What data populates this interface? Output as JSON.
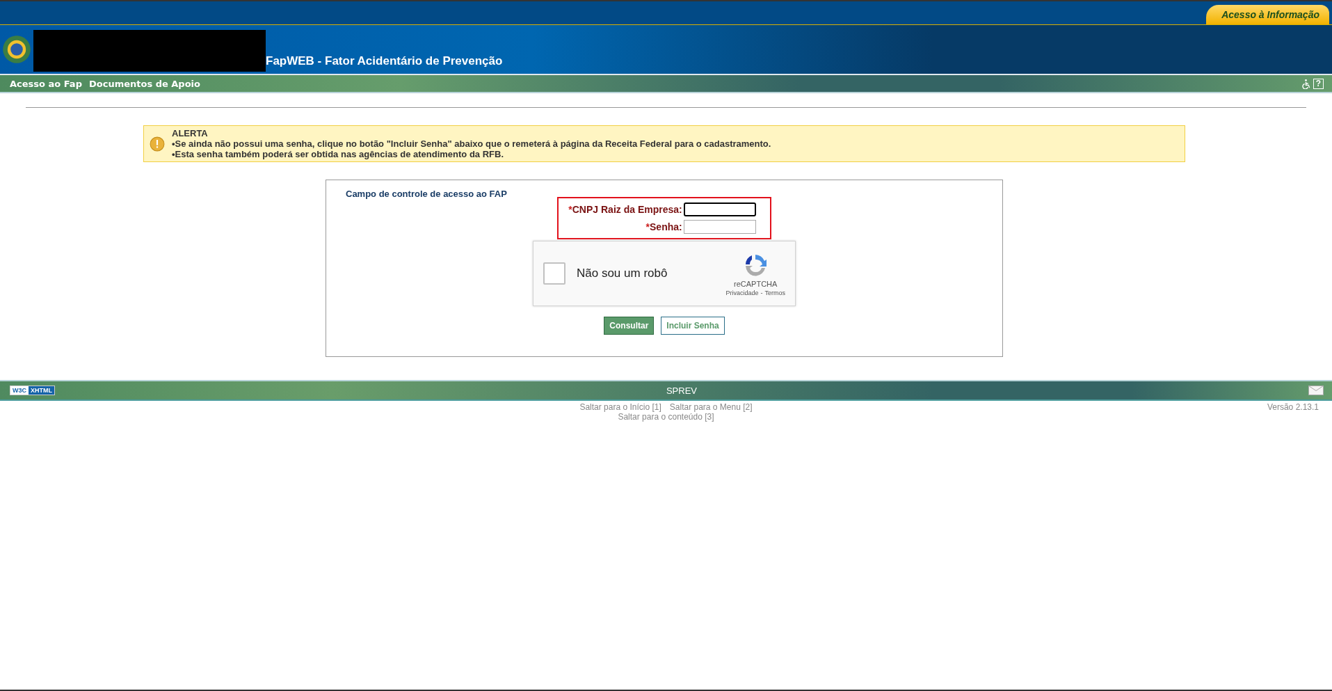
{
  "top_bar": {
    "access_tab": "Acesso à Informação"
  },
  "header": {
    "title": "FapWEB - Fator Acidentário de Prevenção"
  },
  "nav": {
    "items": [
      "Acesso ao Fap",
      "Documentos de Apoio"
    ],
    "help": "?"
  },
  "alert": {
    "title": "ALERTA",
    "lines": [
      "•Se ainda não possui uma senha, clique no botão \"Incluir Senha\" abaixo que o remeterá à página da Receita Federal para o cadastramento.",
      "•Esta senha também poderá ser obtida nas agências de atendimento da RFB."
    ]
  },
  "form": {
    "title": "Campo de controle de acesso ao FAP",
    "fields": [
      {
        "required_mark": "*",
        "label": "CNPJ Raiz da Empresa:",
        "focused": true
      },
      {
        "required_mark": "*",
        "label": "Senha:",
        "focused": false
      }
    ],
    "captcha": {
      "checked": false,
      "label": "Não sou um robô",
      "brand": "reCAPTCHA",
      "links": [
        "Privacidade",
        "Termos"
      ],
      "separator": "-"
    },
    "buttons": [
      {
        "label": "Consultar",
        "kind": "primary"
      },
      {
        "label": "Incluir Senha",
        "kind": "secondary"
      }
    ]
  },
  "footer": {
    "badge": [
      "W3C",
      "XHTML"
    ],
    "title": "SPREV",
    "links": [
      "Saltar para o Início [1]",
      "Saltar para o Menu [2]",
      "Saltar para o conteúdo [3]"
    ],
    "version": "Versão 2.13.1"
  }
}
